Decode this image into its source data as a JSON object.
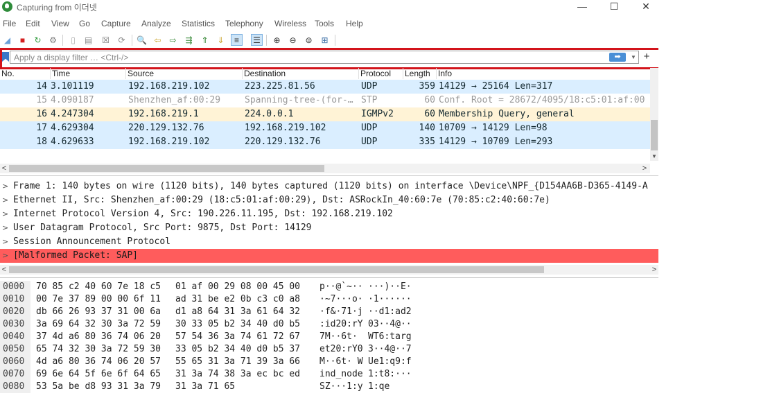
{
  "window": {
    "title": "Capturing from 이더넷",
    "controls": {
      "minimize": "—",
      "maximize": "☐",
      "close": "✕"
    }
  },
  "menu": [
    "File",
    "Edit",
    "View",
    "Go",
    "Capture",
    "Analyze",
    "Statistics",
    "Telephony",
    "Wireless",
    "Tools",
    "Help"
  ],
  "toolbar": [
    {
      "name": "start-capture-icon",
      "glyph": "◢",
      "color": "#6aa0d8"
    },
    {
      "name": "stop-capture-icon",
      "glyph": "■",
      "color": "#d42020"
    },
    {
      "name": "restart-capture-icon",
      "glyph": "↻",
      "color": "#2e9a3a"
    },
    {
      "name": "capture-options-icon",
      "glyph": "⚙",
      "color": "#777777"
    },
    {
      "name": "open-file-icon",
      "glyph": "▯",
      "color": "#aaaaaa"
    },
    {
      "name": "save-file-icon",
      "glyph": "▤",
      "color": "#888888"
    },
    {
      "name": "close-file-icon",
      "glyph": "☒",
      "color": "#777777"
    },
    {
      "name": "reload-file-icon",
      "glyph": "⟳",
      "color": "#888888"
    },
    {
      "name": "find-packet-icon",
      "glyph": "🔍",
      "color": "#333333"
    },
    {
      "name": "go-back-icon",
      "glyph": "⇦",
      "color": "#c9a227"
    },
    {
      "name": "go-forward-icon",
      "glyph": "⇨",
      "color": "#3a8a3a"
    },
    {
      "name": "go-to-packet-icon",
      "glyph": "⇶",
      "color": "#3a8a3a"
    },
    {
      "name": "first-packet-icon",
      "glyph": "⇑",
      "color": "#3a8a3a"
    },
    {
      "name": "last-packet-icon",
      "glyph": "⇓",
      "color": "#c9a227"
    },
    {
      "name": "autoscroll-icon",
      "glyph": "≡",
      "color": "#333333"
    },
    {
      "name": "colorize-icon",
      "glyph": "☰",
      "color": "#333333"
    },
    {
      "name": "zoom-in-icon",
      "glyph": "⊕",
      "color": "#333333"
    },
    {
      "name": "zoom-out-icon",
      "glyph": "⊖",
      "color": "#333333"
    },
    {
      "name": "normal-size-icon",
      "glyph": "⊜",
      "color": "#333333"
    },
    {
      "name": "resize-columns-icon",
      "glyph": "⊞",
      "color": "#3a6ea5"
    }
  ],
  "filter": {
    "placeholder": "Apply a display filter … <Ctrl-/>",
    "value": "",
    "apply_glyph": "➡",
    "dropdown_glyph": "▼",
    "add_glyph": "+"
  },
  "packet_list": {
    "columns": [
      "No.",
      "Time",
      "Source",
      "Destination",
      "Protocol",
      "Length",
      "Info"
    ],
    "rows": [
      {
        "no": "14",
        "time": "3.101119",
        "src": "192.168.219.102",
        "dst": "223.225.81.56",
        "proto": "UDP",
        "len": "359",
        "info": "14129 → 25164 Len=317",
        "bg": "#daeeff",
        "fg": "#12272e"
      },
      {
        "no": "15",
        "time": "4.090187",
        "src": "Shenzhen_af:00:29",
        "dst": "Spanning-tree-(for-…",
        "proto": "STP",
        "len": "60",
        "info": "Conf. Root = 28672/4095/18:c5:01:af:00",
        "bg": "#ffffff",
        "fg": "#9a9a9a"
      },
      {
        "no": "16",
        "time": "4.247304",
        "src": "192.168.219.1",
        "dst": "224.0.0.1",
        "proto": "IGMPv2",
        "len": "60",
        "info": "Membership Query, general",
        "bg": "#fff3d6",
        "fg": "#12272e"
      },
      {
        "no": "17",
        "time": "4.629304",
        "src": "220.129.132.76",
        "dst": "192.168.219.102",
        "proto": "UDP",
        "len": "140",
        "info": "10709 → 14129 Len=98",
        "bg": "#daeeff",
        "fg": "#12272e"
      },
      {
        "no": "18",
        "time": "4.629633",
        "src": "192.168.219.102",
        "dst": "220.129.132.76",
        "proto": "UDP",
        "len": "335",
        "info": "14129 → 10709 Len=293",
        "bg": "#daeeff",
        "fg": "#12272e"
      }
    ]
  },
  "scroll": {
    "left": "<",
    "right": ">",
    "down": "▼"
  },
  "details": [
    {
      "text": "Frame 1: 140 bytes on wire (1120 bits), 140 bytes captured (1120 bits) on interface \\Device\\NPF_{D154AA6B-D365-4149-A",
      "bg": "#ffffff",
      "fg": "#222222"
    },
    {
      "text": "Ethernet II, Src: Shenzhen_af:00:29 (18:c5:01:af:00:29), Dst: ASRockIn_40:60:7e (70:85:c2:40:60:7e)",
      "bg": "#ffffff",
      "fg": "#222222"
    },
    {
      "text": "Internet Protocol Version 4, Src: 190.226.11.195, Dst: 192.168.219.102",
      "bg": "#ffffff",
      "fg": "#222222"
    },
    {
      "text": "User Datagram Protocol, Src Port: 9875, Dst Port: 14129",
      "bg": "#ffffff",
      "fg": "#222222"
    },
    {
      "text": "Session Announcement Protocol",
      "bg": "#ffffff",
      "fg": "#222222"
    },
    {
      "text": "[Malformed Packet: SAP]",
      "bg": "#ff5c5c",
      "fg": "#1a1a1a"
    }
  ],
  "details_chevron": ">",
  "hex": [
    {
      "off": "0000",
      "b1": "70 85 c2 40 60 7e 18 c5",
      "b2": "01 af 00 29 08 00 45 00",
      "a1": "p··@`~··",
      "a2": "···)··E·"
    },
    {
      "off": "0010",
      "b1": "00 7e 37 89 00 00 6f 11",
      "b2": "ad 31 be e2 0b c3 c0 a8",
      "a1": "·~7···o·",
      "a2": "·1······"
    },
    {
      "off": "0020",
      "b1": "db 66 26 93 37 31 00 6a",
      "b2": "d1 a8 64 31 3a 61 64 32",
      "a1": "·f&·71·j",
      "a2": "··d1:ad2"
    },
    {
      "off": "0030",
      "b1": "3a 69 64 32 30 3a 72 59",
      "b2": "30 33 05 b2 34 40 d0 b5",
      "a1": ":id20:rY",
      "a2": "03··4@··"
    },
    {
      "off": "0040",
      "b1": "37 4d a6 80 36 74 06 20",
      "b2": "57 54 36 3a 74 61 72 67",
      "a1": "7M··6t· ",
      "a2": "WT6:targ"
    },
    {
      "off": "0050",
      "b1": "65 74 32 30 3a 72 59 30",
      "b2": "33 05 b2 34 40 d0 b5 37",
      "a1": "et20:rY0",
      "a2": "3··4@··7"
    },
    {
      "off": "0060",
      "b1": "4d a6 80 36 74 06 20 57",
      "b2": "55 65 31 3a 71 39 3a 66",
      "a1": "M··6t· W",
      "a2": "Ue1:q9:f"
    },
    {
      "off": "0070",
      "b1": "69 6e 64 5f 6e 6f 64 65",
      "b2": "31 3a 74 38 3a ec bc ed",
      "a1": "ind_node",
      "a2": "1:t8:···"
    },
    {
      "off": "0080",
      "b1": "53 5a be d8 93 31 3a 79",
      "b2": "31 3a 71 65",
      "a1": "SZ···1:y",
      "a2": "1:qe"
    }
  ]
}
